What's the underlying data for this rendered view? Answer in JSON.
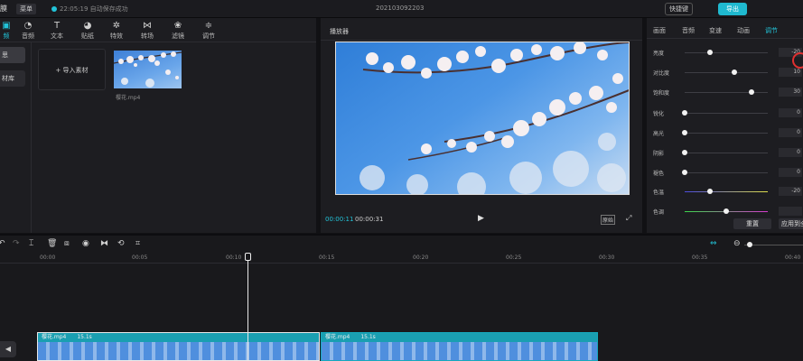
{
  "titlebar": {
    "app": "膜",
    "menu": "菜单",
    "save_status": "22:05:19 自动保存成功",
    "project": "202103092203",
    "shortcuts": "快捷键",
    "export": "导出"
  },
  "toolbar": [
    "音频",
    "文本",
    "贴纸",
    "特效",
    "转场",
    "滤镜",
    "调节"
  ],
  "toolbar_first": "频",
  "toolbar_icons": [
    "music-icon",
    "text-icon",
    "sticker-icon",
    "effects-icon",
    "transition-icon",
    "filter-icon",
    "adjust-icon"
  ],
  "media": {
    "side_tabs": [
      "思",
      "材库"
    ],
    "import_label": "+ 导入素材",
    "file_name": "樱花.mp4"
  },
  "player": {
    "title": "播放器",
    "current_time": "00:00:11",
    "total_time": "00:00:31",
    "ratio": "原始"
  },
  "props": {
    "tabs": [
      "画面",
      "音频",
      "变速",
      "动画",
      "调节"
    ],
    "sliders": [
      {
        "label": "亮度",
        "value": "-20",
        "level": 0.3
      },
      {
        "label": "对比度",
        "value": "10",
        "level": 0.6
      },
      {
        "label": "饱和度",
        "value": "30",
        "level": 0.8
      },
      {
        "label": "锐化",
        "value": "0",
        "level": 0.0
      },
      {
        "label": "高光",
        "value": "0",
        "level": 0.0
      },
      {
        "label": "阴影",
        "value": "0",
        "level": 0.0
      },
      {
        "label": "褪色",
        "value": "0",
        "level": 0.0
      },
      {
        "label": "色温",
        "value": "-20",
        "level": 0.3
      },
      {
        "label": "色调",
        "value": "",
        "level": 0.5
      }
    ],
    "reset": "重置",
    "apply_all": "应用到全部"
  },
  "timeline": {
    "ruler": [
      "00:00",
      "00:05",
      "00:10",
      "00:15",
      "00:20",
      "00:25",
      "00:30",
      "00:35",
      "00:40"
    ],
    "clips": [
      {
        "name": "樱花.mp4",
        "duration": "15.1s"
      },
      {
        "name": "樱花.mp4",
        "duration": "15.1s"
      }
    ]
  }
}
